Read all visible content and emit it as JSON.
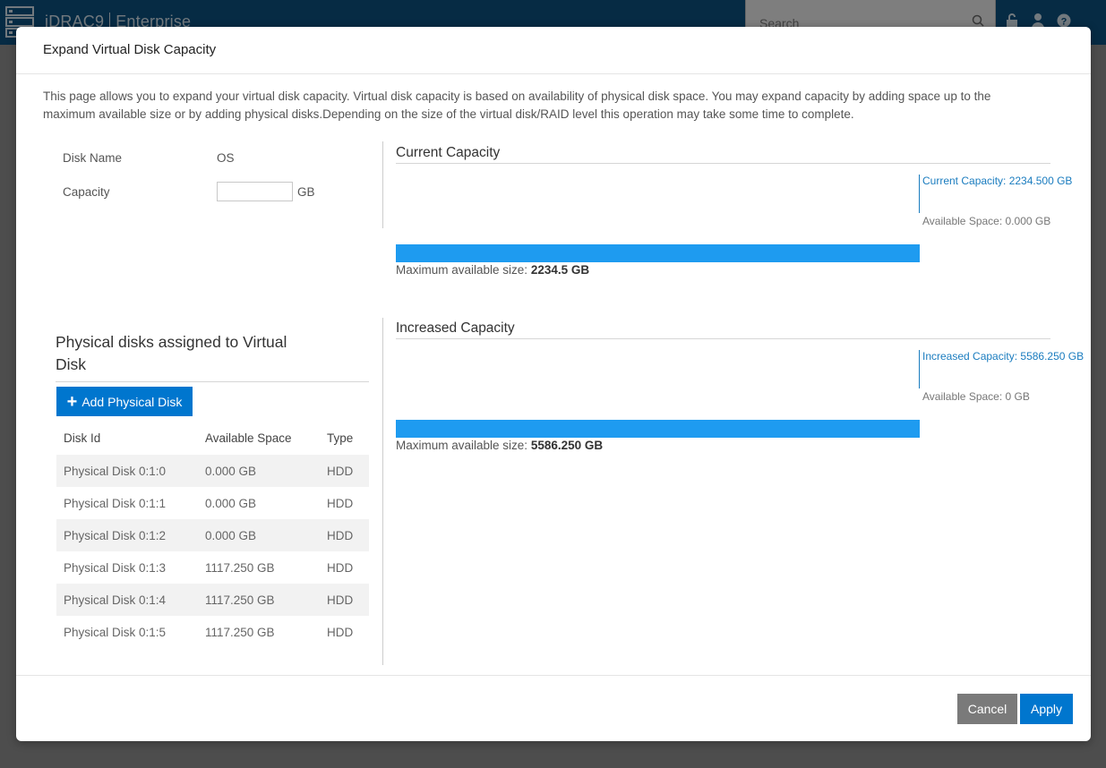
{
  "app": {
    "brand": "iDRAC9",
    "edition": "Enterprise",
    "search_placeholder": "Search"
  },
  "modal": {
    "title": "Expand Virtual Disk Capacity",
    "intro": "This page allows you to expand your virtual disk capacity. Virtual disk capacity is based on availability of physical disk space. You may expand capacity by adding space up to the maximum available size or by adding physical disks.Depending on the size of the virtual disk/RAID level this operation may take some time to complete.",
    "form": {
      "disk_name_label": "Disk Name",
      "disk_name_value": "OS",
      "capacity_label": "Capacity",
      "capacity_value": "",
      "capacity_unit": "GB"
    },
    "current": {
      "title": "Current Capacity",
      "legend_capacity": "Current Capacity: 2234.500 GB",
      "legend_available": "Available Space: 0.000 GB",
      "max_label": "Maximum available size:",
      "max_value": "2234.5 GB",
      "fill_fraction": 1.0
    },
    "increased": {
      "title": "Increased Capacity",
      "legend_capacity": "Increased Capacity: 5586.250 GB",
      "legend_available": "Available Space: 0 GB",
      "max_label": "Maximum available size:",
      "max_value": "5586.250 GB",
      "fill_fraction": 1.0
    },
    "physical": {
      "title": "Physical disks assigned to Virtual Disk",
      "add_button": "Add Physical Disk",
      "columns": [
        "Disk Id",
        "Available Space",
        "Type"
      ],
      "rows": [
        [
          "Physical Disk 0:1:0",
          "0.000 GB",
          "HDD"
        ],
        [
          "Physical Disk 0:1:1",
          "0.000 GB",
          "HDD"
        ],
        [
          "Physical Disk 0:1:2",
          "0.000 GB",
          "HDD"
        ],
        [
          "Physical Disk 0:1:3",
          "1117.250 GB",
          "HDD"
        ],
        [
          "Physical Disk 0:1:4",
          "1117.250 GB",
          "HDD"
        ],
        [
          "Physical Disk 0:1:5",
          "1117.250 GB",
          "HDD"
        ]
      ]
    },
    "buttons": {
      "cancel": "Cancel",
      "apply": "Apply"
    }
  },
  "colors": {
    "primary": "#0076ce",
    "bar_fill": "#1e9bf0",
    "legend_blue": "#1a7cbf",
    "cancel": "#7a7a7a"
  }
}
